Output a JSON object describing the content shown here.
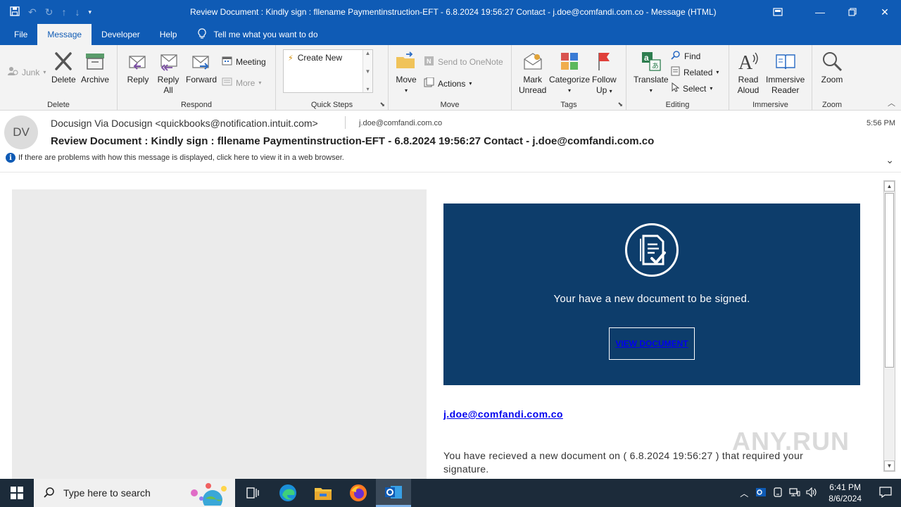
{
  "window": {
    "title": "Review Document : Kindly sign : fllename Paymentinstruction-EFT - 6.8.2024 19:56:27 Contact - j.doe@comfandi.com.co  -  Message (HTML)"
  },
  "menu": {
    "tabs": [
      "File",
      "Message",
      "Developer",
      "Help"
    ],
    "active_tab": "Message",
    "tell_me": "Tell me what you want to do"
  },
  "ribbon": {
    "delete_group": {
      "label": "Delete",
      "junk": "Junk",
      "delete": "Delete",
      "archive": "Archive"
    },
    "respond_group": {
      "label": "Respond",
      "reply": "Reply",
      "reply_all_1": "Reply",
      "reply_all_2": "All",
      "forward": "Forward",
      "meeting": "Meeting",
      "more": "More"
    },
    "quick_steps_group": {
      "label": "Quick Steps",
      "create_new": "Create New"
    },
    "move_group": {
      "label": "Move",
      "move": "Move",
      "send_onenote": "Send to OneNote",
      "actions": "Actions"
    },
    "tags_group": {
      "label": "Tags",
      "mark_unread_1": "Mark",
      "mark_unread_2": "Unread",
      "categorize": "Categorize",
      "follow_up_1": "Follow",
      "follow_up_2": "Up"
    },
    "editing_group": {
      "label": "Editing",
      "translate": "Translate",
      "find": "Find",
      "related": "Related",
      "select": "Select"
    },
    "immersive_group": {
      "label": "Immersive",
      "read_aloud_1": "Read",
      "read_aloud_2": "Aloud",
      "immersive_reader_1": "Immersive",
      "immersive_reader_2": "Reader"
    },
    "zoom_group": {
      "label": "Zoom",
      "zoom": "Zoom"
    }
  },
  "header": {
    "avatar_initials": "DV",
    "sender": "Docusign Via Docusign <quickbooks@notification.intuit.com>",
    "recipient": "j.doe@comfandi.com.co",
    "time": "5:56 PM",
    "subject": "Review Document : Kindly sign : fllename Paymentinstruction-EFT - 6.8.2024 19:56:27 Contact - j.doe@comfandi.com.co",
    "info": "If there are problems with how this message is displayed, click here to view it in a web browser."
  },
  "body": {
    "banner_text": "Your have a new document to be signed.",
    "view_button": "VIEW DOCUMENT",
    "email_link": "j.doe@comfandi.com.co",
    "paragraph": "You have recieved a new document on (  6.8.2024  19:56:27  ) that required your signature.",
    "watermark": "ANY.RUN",
    "banner_color": "#0d3d6b"
  },
  "taskbar": {
    "search_placeholder": "Type here to search",
    "time": "6:41 PM",
    "date": "8/6/2024"
  },
  "colors": {
    "accent": "#0f5bb5",
    "taskbar": "#1c2b3a"
  }
}
